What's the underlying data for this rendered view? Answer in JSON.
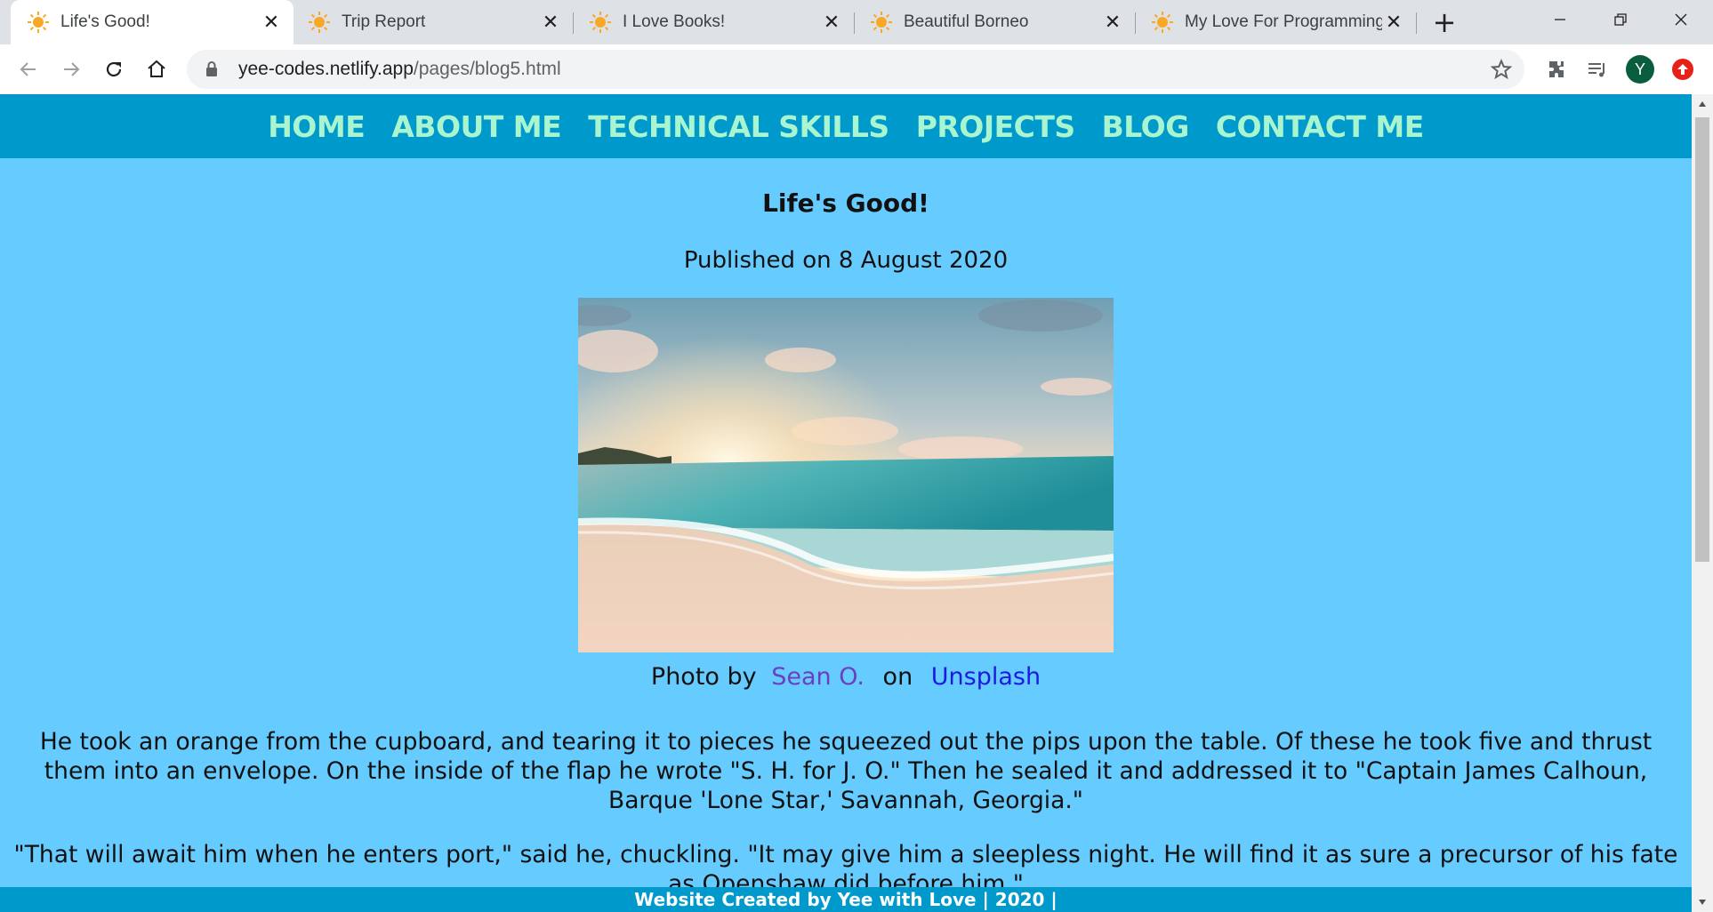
{
  "browser": {
    "tabs": [
      {
        "title": "Life's Good!",
        "icon": "sun-favicon-icon",
        "active": true
      },
      {
        "title": "Trip Report",
        "icon": "sun-favicon-icon",
        "active": false
      },
      {
        "title": "I Love Books!",
        "icon": "sun-favicon-icon",
        "active": false
      },
      {
        "title": "Beautiful Borneo",
        "icon": "sun-favicon-icon",
        "active": false
      },
      {
        "title": "My Love For Programming",
        "icon": "sun-favicon-icon",
        "active": false
      }
    ],
    "new_tab": "+",
    "url_host": "yee-codes.netlify.app",
    "url_path": "/pages/blog5.html",
    "profile_initial": "Y",
    "colors": {
      "profile": "#0b5e3d",
      "update": "#e62117"
    }
  },
  "site": {
    "nav": [
      "HOME",
      "ABOUT ME",
      "TECHNICAL SKILLS",
      "PROJECTS",
      "BLOG",
      "CONTACT ME"
    ],
    "colors": {
      "nav_bg": "#0099cc",
      "nav_text": "#a8f5d0",
      "page_bg": "#66ccff"
    }
  },
  "post": {
    "title": "Life's Good!",
    "date": "Published on 8 August 2020",
    "image_alt": "beach at sunset",
    "credit_prefix": "Photo by",
    "credit_author": "Sean O.",
    "credit_on": "on",
    "credit_site": "Unsplash",
    "paragraphs": [
      "He took an orange from the cupboard, and tearing it to pieces he squeezed out the pips upon the table. Of these he took five and thrust them into an envelope. On the inside of the flap he wrote \"S. H. for J. O.\" Then he sealed it and addressed it to \"Captain James Calhoun, Barque 'Lone Star,' Savannah, Georgia.\"",
      "\"That will await him when he enters port,\" said he, chuckling. \"It may give him a sleepless night. He will find it as sure a precursor of his fate as Openshaw did before him.\""
    ]
  },
  "footer": {
    "text": "Website Created by Yee with Love | 2020 |"
  }
}
